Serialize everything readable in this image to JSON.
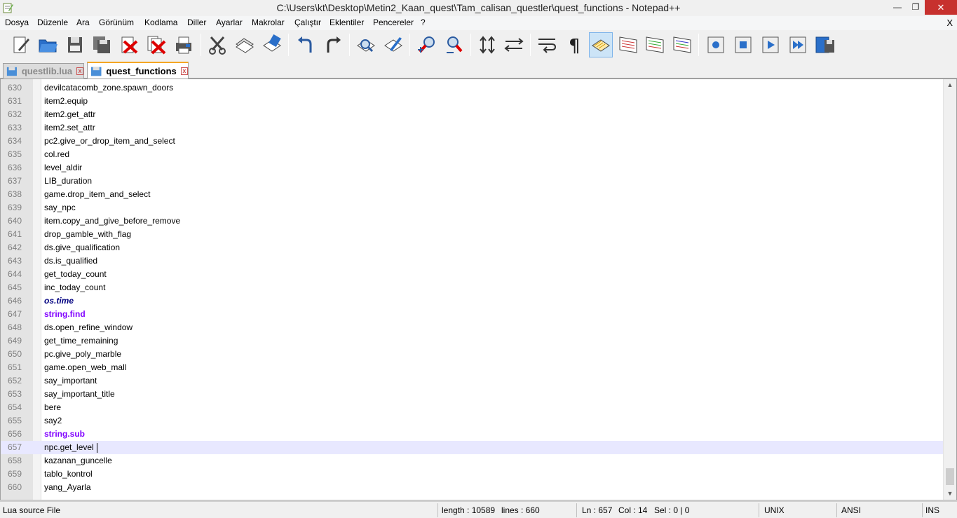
{
  "window": {
    "title": "C:\\Users\\kt\\Desktop\\Metin2_Kaan_quest\\Tam_calisan_questler\\quest_functions - Notepad++",
    "minimize_glyph": "—",
    "maximize_glyph": "❐",
    "close_glyph": "✕"
  },
  "menu": {
    "items": [
      "Dosya",
      "Düzenle",
      "Ara",
      "Görünüm",
      "Kodlama",
      "Diller",
      "Ayarlar",
      "Makrolar",
      "Çalıştır",
      "Eklentiler",
      "Pencereler",
      "?"
    ],
    "close_glyph": "X"
  },
  "toolbar": {
    "buttons": [
      "new-file",
      "open-file",
      "save",
      "save-all",
      "close",
      "close-all",
      "print",
      "cut",
      "copy",
      "paste",
      "undo",
      "redo",
      "find",
      "replace",
      "zoom-in",
      "zoom-out",
      "sync-vertical",
      "sync-horizontal",
      "word-wrap",
      "show-all-chars",
      "indent-guide",
      "doc-map",
      "function-list",
      "folder-as-workspace",
      "record-macro",
      "stop-recording",
      "play-macro",
      "run-macro-multiple",
      "save-macro"
    ],
    "active_button": "indent-guide"
  },
  "tabs": [
    {
      "label": "questlib.lua",
      "active": false
    },
    {
      "label": "quest_functions",
      "active": true
    }
  ],
  "editor": {
    "current_line": 657,
    "lines": [
      {
        "n": "630",
        "text": "devilcatacomb_zone.spawn_doors",
        "style": "plain"
      },
      {
        "n": "631",
        "text": "item2.equip",
        "style": "plain"
      },
      {
        "n": "632",
        "text": "item2.get_attr",
        "style": "plain"
      },
      {
        "n": "633",
        "text": "item2.set_attr",
        "style": "plain"
      },
      {
        "n": "634",
        "text": "pc2.give_or_drop_item_and_select",
        "style": "plain"
      },
      {
        "n": "635",
        "text": "col.red",
        "style": "plain"
      },
      {
        "n": "636",
        "text": "level_aldir",
        "style": "plain"
      },
      {
        "n": "637",
        "text": "LIB_duration",
        "style": "plain"
      },
      {
        "n": "638",
        "text": "game.drop_item_and_select",
        "style": "plain"
      },
      {
        "n": "639",
        "text": "say_npc",
        "style": "plain"
      },
      {
        "n": "640",
        "text": "item.copy_and_give_before_remove",
        "style": "plain"
      },
      {
        "n": "641",
        "text": "drop_gamble_with_flag",
        "style": "plain"
      },
      {
        "n": "642",
        "text": "ds.give_qualification",
        "style": "plain"
      },
      {
        "n": "643",
        "text": "ds.is_qualified",
        "style": "plain"
      },
      {
        "n": "644",
        "text": "get_today_count",
        "style": "plain"
      },
      {
        "n": "645",
        "text": "inc_today_count",
        "style": "plain"
      },
      {
        "n": "646",
        "text": "os.time",
        "style": "fn"
      },
      {
        "n": "647",
        "text": "string.find",
        "style": "str"
      },
      {
        "n": "648",
        "text": "ds.open_refine_window",
        "style": "plain"
      },
      {
        "n": "649",
        "text": "get_time_remaining",
        "style": "plain"
      },
      {
        "n": "650",
        "text": "pc.give_poly_marble",
        "style": "plain"
      },
      {
        "n": "651",
        "text": "game.open_web_mall",
        "style": "plain"
      },
      {
        "n": "652",
        "text": "say_important",
        "style": "plain"
      },
      {
        "n": "653",
        "text": "say_important_title",
        "style": "plain"
      },
      {
        "n": "654",
        "text": "bere",
        "style": "plain"
      },
      {
        "n": "655",
        "text": "say2",
        "style": "plain"
      },
      {
        "n": "656",
        "text": "string.sub",
        "style": "str"
      },
      {
        "n": "657",
        "text": "npc.get_level",
        "style": "plain"
      },
      {
        "n": "658",
        "text": "kazanan_guncelle",
        "style": "plain"
      },
      {
        "n": "659",
        "text": "tablo_kontrol",
        "style": "plain"
      },
      {
        "n": "660",
        "text": "yang_Ayarla",
        "style": "plain"
      }
    ]
  },
  "statusbar": {
    "file_type": "Lua source File",
    "length": "length : 10589",
    "lines": "lines : 660",
    "ln": "Ln : 657",
    "col": "Col : 14",
    "sel": "Sel : 0 | 0",
    "eol": "UNIX",
    "encoding": "ANSI",
    "mode": "INS"
  },
  "colors": {
    "active_tab_accent": "#f5a623",
    "current_line_bg": "#e8e8ff",
    "lua_function_kw": "#000080",
    "lua_string_kw": "#8000ff"
  }
}
